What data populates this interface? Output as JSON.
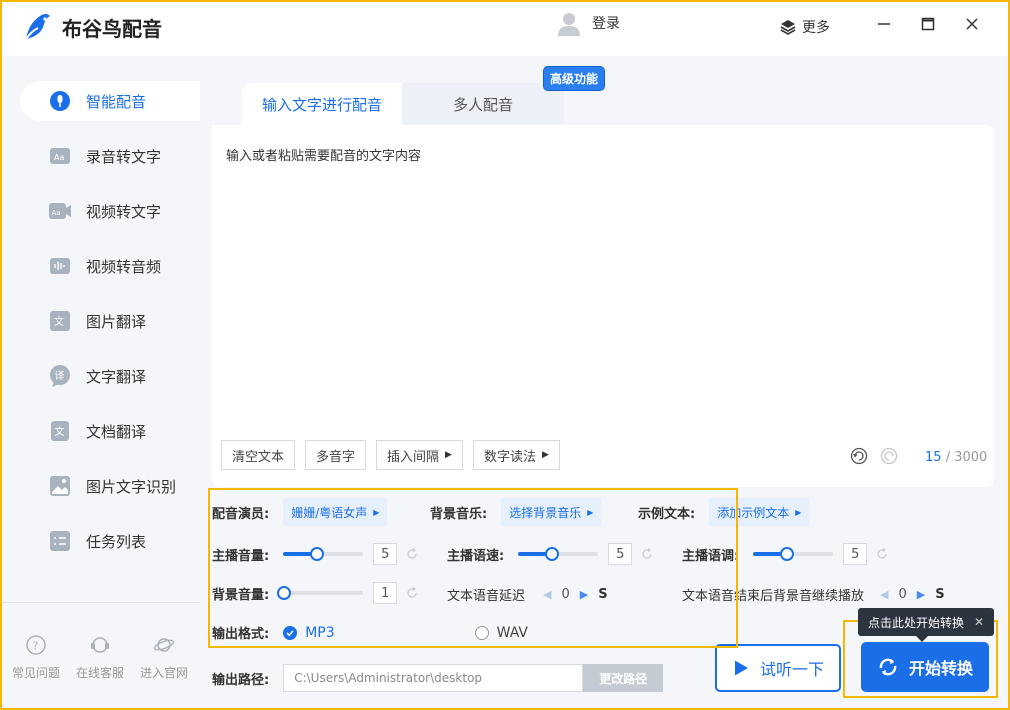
{
  "app": {
    "title": "布谷鸟配音"
  },
  "header": {
    "login": "登录",
    "more": "更多"
  },
  "sidebar": {
    "items": [
      {
        "label": "智能配音",
        "icon": "mic-icon"
      },
      {
        "label": "录音转文字",
        "icon": "text-aa-icon"
      },
      {
        "label": "视频转文字",
        "icon": "video-text-icon"
      },
      {
        "label": "视频转音频",
        "icon": "audio-wave-icon"
      },
      {
        "label": "图片翻译",
        "icon": "image-translate-icon"
      },
      {
        "label": "文字翻译",
        "icon": "chat-translate-icon"
      },
      {
        "label": "文档翻译",
        "icon": "doc-translate-icon"
      },
      {
        "label": "图片文字识别",
        "icon": "image-ocr-icon"
      },
      {
        "label": "任务列表",
        "icon": "task-list-icon"
      }
    ],
    "bottom": [
      {
        "label": "常见问题",
        "icon": "question-icon"
      },
      {
        "label": "在线客服",
        "icon": "headset-icon"
      },
      {
        "label": "进入官网",
        "icon": "planet-icon"
      }
    ]
  },
  "tabs": {
    "input_text": "输入文字进行配音",
    "multi": "多人配音",
    "badge": "高级功能"
  },
  "editor": {
    "placeholder": "输入或者粘贴需要配音的文字内容",
    "buttons": {
      "clear": "清空文本",
      "polyphone": "多音字",
      "pause": "插入间隔",
      "number": "数字读法"
    },
    "count_current": "15",
    "count_max": "/ 3000"
  },
  "settings": {
    "voice_label": "配音演员:",
    "voice_value": "姗姗/粤语女声",
    "bgm_label": "背景音乐:",
    "bgm_value": "选择背景音乐",
    "sample_label": "示例文本:",
    "sample_value": "添加示例文本",
    "main_volume_label": "主播音量:",
    "main_volume": "5",
    "speed_label": "主播语速:",
    "speed": "5",
    "pitch_label": "主播语调:",
    "pitch": "5",
    "bg_volume_label": "背景音量:",
    "bg_volume": "1",
    "delay_label": "文本语音延迟",
    "delay": "0",
    "delay_unit": "S",
    "after_label": "文本语音结束后背景音继续播放",
    "after": "0",
    "after_unit": "S",
    "format_label": "输出格式:",
    "format_mp3": "MP3",
    "format_wav": "WAV",
    "path_label": "输出路径:",
    "path_value": "C:\\Users\\Administrator\\desktop",
    "path_button": "更改路径"
  },
  "actions": {
    "preview": "试听一下",
    "start": "开始转换",
    "tooltip": "点击此处开始转换"
  },
  "colors": {
    "accent": "#1a6fe8",
    "highlight": "#f5b800",
    "badge": "#2a7ff0"
  }
}
